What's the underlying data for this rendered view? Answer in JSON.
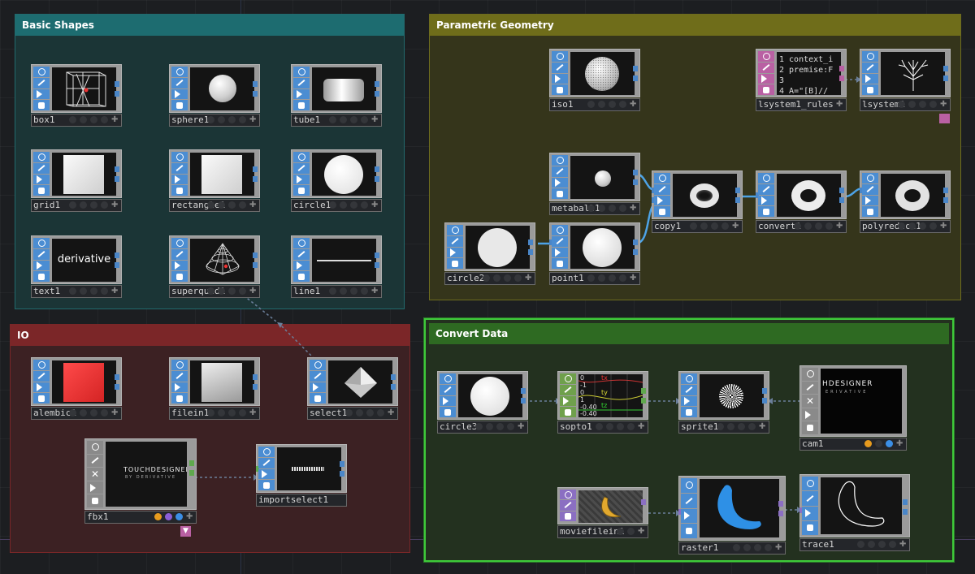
{
  "boxes": {
    "basic_shapes": "Basic Shapes",
    "parametric_geometry": "Parametric Geometry",
    "io": "IO",
    "convert_data": "Convert Data"
  },
  "nodes": {
    "box1": "box1",
    "sphere1": "sphere1",
    "tube1": "tube1",
    "grid1": "grid1",
    "rectangle1": "rectangle1",
    "circle1": "circle1",
    "text1": "text1",
    "superquad1": "superquad1",
    "line1": "line1",
    "iso1": "iso1",
    "lsystem1_rules": "lsystem1_rules",
    "lsystem1": "lsystem1",
    "metaball1": "metaball1",
    "copy1": "copy1",
    "convert1": "convert1",
    "polyreduce1": "polyreduce1",
    "circle2": "circle2",
    "point1": "point1",
    "alembic1": "alembic1",
    "filein1": "filein1",
    "select1": "select1",
    "fbx1": "fbx1",
    "importselect1": "importselect1",
    "circle3": "circle3",
    "sopto1": "sopto1",
    "sprite1": "sprite1",
    "cam1": "cam1",
    "moviefilein1": "moviefilein1",
    "raster1": "raster1",
    "trace1": "trace1"
  },
  "viewer_text": {
    "text1": "derivative",
    "rules_lines": [
      "1 context_i",
      "2 premise:F",
      "3",
      "4 A=\"[B]//"
    ],
    "fbx_logo": "TOUCHDESIGNER",
    "fbx_sub": "BY DERIVATIVE",
    "cam_logo": "HDESIGNER",
    "cam_sub": "ERIVATIVE",
    "sopto_rows": [
      "0",
      "-1",
      "tx",
      "0",
      "ty",
      "1",
      "tz",
      "-0.40",
      "-0.40"
    ]
  },
  "icons": {
    "flag1": "viewer-icon",
    "flag2": "pencil-icon",
    "flag3": "arrow-icon",
    "flag4": "lock-icon"
  },
  "colors": {
    "basic": "#1c6a6f",
    "parametric": "#6f6d19",
    "io": "#7a2526",
    "convert": "#2f6a20",
    "flag": "#4b8dd2",
    "wire": "#4da3e6"
  }
}
